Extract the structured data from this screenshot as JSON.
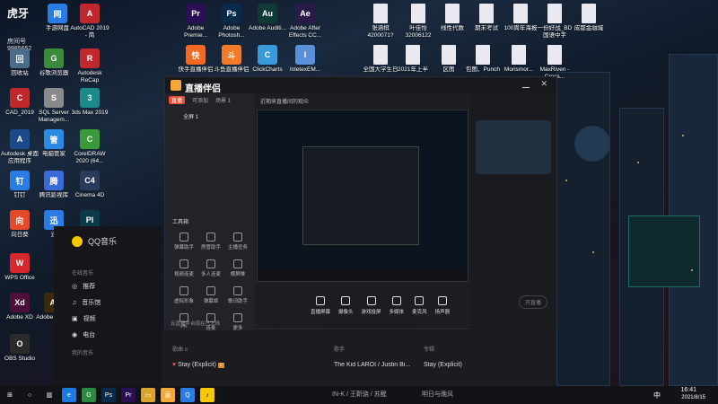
{
  "watermark": {
    "brand": "虎牙",
    "room_label": "房间号",
    "room_id": "9985652"
  },
  "desktop_icons": [
    {
      "label": "手游网盘",
      "color": "#2a7be4",
      "glyph": "网"
    },
    {
      "label": "AutoCAD 2019 - 简",
      "color": "#c0282d",
      "glyph": "A"
    },
    {
      "label": "Adobe Premie...",
      "color": "#2a0f55",
      "glyph": "Pr"
    },
    {
      "label": "Adobe Photosh...",
      "color": "#0a2a4a",
      "glyph": "Ps"
    },
    {
      "label": "Adobe Auditi...",
      "color": "#0f3a35",
      "glyph": "Au"
    },
    {
      "label": "Adobe After Effects CC...",
      "color": "#2a1a4a",
      "glyph": "Ae"
    },
    {
      "label": "快手直播伴侣",
      "color": "#f26a21",
      "glyph": "快"
    },
    {
      "label": "斗鱼直播伴侣",
      "color": "#f27b2a",
      "glyph": "斗"
    },
    {
      "label": "ClickCharts",
      "color": "#3a9ad9",
      "glyph": "C"
    },
    {
      "label": "InletexEM...",
      "color": "#5a8fd9",
      "glyph": "I"
    },
    {
      "label": "回收站",
      "color": "#4b6b8a",
      "glyph": "回"
    },
    {
      "label": "谷歌浏览器",
      "color": "#3b8a3b",
      "glyph": "G"
    },
    {
      "label": "Autodesk ReCap",
      "color": "#c0282d",
      "glyph": "R"
    },
    {
      "label": "CAD_2019",
      "color": "#c0282d",
      "glyph": "C"
    },
    {
      "label": "SQL Server Managem...",
      "color": "#8a8a8a",
      "glyph": "S"
    },
    {
      "label": "3ds Max 2019",
      "color": "#1a8a8a",
      "glyph": "3"
    },
    {
      "label": "Autodesk 桌面应用程序",
      "color": "#1a4a8a",
      "glyph": "A"
    },
    {
      "label": "电脑管家",
      "color": "#2a8ae4",
      "glyph": "管"
    },
    {
      "label": "CorelDRAW 2020 (64...",
      "color": "#3a9a3a",
      "glyph": "C"
    },
    {
      "label": "钉钉",
      "color": "#2a7be4",
      "glyph": "钉"
    },
    {
      "label": "腾讯影视库",
      "color": "#3a6ad9",
      "glyph": "腾"
    },
    {
      "label": "Cinema 4D",
      "color": "#2a3a5a",
      "glyph": "C4"
    },
    {
      "label": "向日葵",
      "color": "#e44a2a",
      "glyph": "向"
    },
    {
      "label": "迅",
      "color": "#2a7be4",
      "glyph": "迅"
    },
    {
      "label": "Pl",
      "color": "#0a3a4a",
      "glyph": "Pl"
    },
    {
      "label": "WPS Office",
      "color": "#d9282d",
      "glyph": "W"
    },
    {
      "label": "Adobe XD",
      "color": "#4a0f3a",
      "glyph": "Xd"
    },
    {
      "label": "Adobe Illust...",
      "color": "#3a2a0a",
      "glyph": "Ai"
    },
    {
      "label": "OBS Studio",
      "color": "#2a2a2a",
      "glyph": "O"
    }
  ],
  "top_files": [
    {
      "label": "张涵棋 4200071?"
    },
    {
      "label": "叶佳怡 32006122"
    },
    {
      "label": "线性代数"
    },
    {
      "label": "期末考试"
    },
    {
      "label": "100周年海报"
    },
    {
      "label": "一份好战_BD 国语中字"
    },
    {
      "label": "成都金融城"
    },
    {
      "label": "全国大学生日"
    },
    {
      "label": "2021年上半"
    },
    {
      "label": "区图"
    },
    {
      "label": "包图、Punch"
    },
    {
      "label": "Morismor..."
    },
    {
      "label": "MaxRiven - Cross..."
    }
  ],
  "app": {
    "title": "直播伴侣",
    "tabs": [
      "直播",
      "可添加",
      "场景 1"
    ],
    "scene_label": "全屏 1",
    "tools_title": "工具箱",
    "tools": [
      "弹幕助手",
      "房管助手",
      "主播任务",
      "视频连麦",
      "多人连麦",
      "横屏推",
      "虚拟形象",
      "弹幕姬",
      "歌词助手",
      "PK",
      "连麦",
      "更多"
    ],
    "bottom_controls": [
      "直播屏幕",
      "摄像头",
      "游戏投屏",
      "多媒体",
      "麦克风",
      "扬声器"
    ],
    "status_text": "开直播",
    "notice": "云直播平台现在已上线",
    "breadcrumb": "近期来直播间的观众"
  },
  "qq_music": {
    "app_name": "QQ音乐",
    "section_online": "在线音乐",
    "items": [
      "推荐",
      "音乐馆",
      "视频",
      "电台"
    ],
    "section_mine": "我的音乐"
  },
  "music_list": {
    "headers": [
      "歌曲 ≡",
      "歌手",
      "专辑"
    ],
    "track_title": "Stay (Explicit)",
    "track_artist": "The Kid LAROI / Justin Bi...",
    "track_album": "Stay (Explicit)",
    "next_artist": "IN-K / 王靳骁 / 苏醒",
    "next_album": "明日与晚风"
  },
  "taskbar": {
    "time": "16:41",
    "date": "2021/8/15",
    "lang": "中"
  }
}
